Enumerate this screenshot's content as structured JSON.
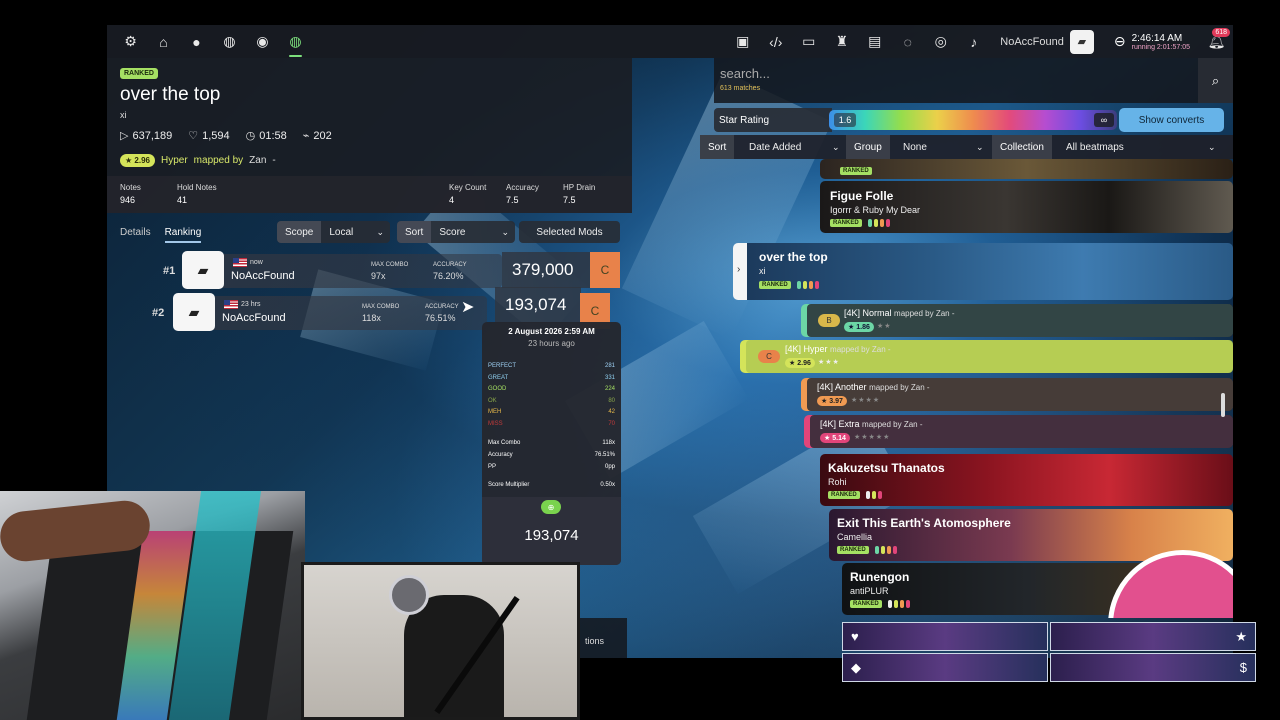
{
  "toolbar": {
    "left_icons": [
      "gear-icon",
      "home-icon",
      "osu-mode-icon",
      "taiko-mode-icon",
      "catch-mode-icon",
      "mania-mode-icon"
    ],
    "right_icons": [
      "rss-icon",
      "code-icon",
      "tv-icon",
      "ranking-icon",
      "wiki-icon",
      "chat-icon",
      "globe-icon",
      "music-icon"
    ],
    "username": "NoAccFound",
    "clock_time": "2:46:14 AM",
    "clock_running": "running 2:01:57:05",
    "notifications": "618"
  },
  "beatmap": {
    "status": "RANKED",
    "title": "over the top",
    "artist": "xi",
    "plays": "637,189",
    "favourites": "1,594",
    "length": "01:58",
    "bpm": "202",
    "star_rating": "2.96",
    "difficulty": "Hyper",
    "mapped_by": "mapped by",
    "mapper": "Zan",
    "dash": "-",
    "stats": [
      {
        "label": "Notes",
        "value": "946"
      },
      {
        "label": "Hold Notes",
        "value": "41"
      },
      {
        "label": "Key Count",
        "value": "4"
      },
      {
        "label": "Accuracy",
        "value": "7.5"
      },
      {
        "label": "HP Drain",
        "value": "7.5"
      }
    ]
  },
  "leaderboard": {
    "tabs": [
      "Details",
      "Ranking"
    ],
    "scope_label": "Scope",
    "scope_value": "Local",
    "sort_label": "Sort",
    "sort_value": "Score",
    "mods_label": "Selected Mods",
    "max_combo_label": "MAX COMBO",
    "accuracy_label": "ACCURACY",
    "scores": [
      {
        "rank": "#1",
        "time": "now",
        "name": "NoAccFound",
        "combo": "97x",
        "accuracy": "76.20%",
        "score": "379,000",
        "grade": "C"
      },
      {
        "rank": "#2",
        "time": "23 hrs",
        "name": "NoAccFound",
        "combo": "118x",
        "accuracy": "76.51%",
        "score": "193,074",
        "grade": "C"
      }
    ]
  },
  "tooltip": {
    "date": "2 August 2026 2:59 AM",
    "ago": "23 hours ago",
    "judgements": [
      {
        "label": "PERFECT",
        "value": "281",
        "color": "#9fd2f5"
      },
      {
        "label": "GREAT",
        "value": "331",
        "color": "#8fd0f0"
      },
      {
        "label": "GOOD",
        "value": "224",
        "color": "#a5e063"
      },
      {
        "label": "OK",
        "value": "80",
        "color": "#8aa74a"
      },
      {
        "label": "MEH",
        "value": "42",
        "color": "#e8b94a"
      },
      {
        "label": "MISS",
        "value": "70",
        "color": "#c43a3a"
      }
    ],
    "details": [
      {
        "label": "Max Combo",
        "value": "118x"
      },
      {
        "label": "Accuracy",
        "value": "76.51%"
      },
      {
        "label": "PP",
        "value": "0pp"
      }
    ],
    "multiplier_label": "Score Multiplier",
    "multiplier_value": "0.50x",
    "score": "193,074"
  },
  "search": {
    "placeholder": "search...",
    "matches": "613 matches",
    "star_rating_label": "Star Rating",
    "star_min": "1.6",
    "star_max": "∞",
    "show_converts": "Show converts",
    "sort_label": "Sort",
    "sort_value": "Date Added",
    "group_label": "Group",
    "group_value": "None",
    "collection_label": "Collection",
    "collection_value": "All beatmaps"
  },
  "carousel": {
    "sets": [
      {
        "title": "Figue Folle",
        "artist": "Igorrr & Ruby My Dear",
        "status": "RANKED"
      },
      {
        "title": "over the top",
        "artist": "xi",
        "status": "RANKED"
      },
      {
        "title": "Kakuzetsu Thanatos",
        "artist": "Rohi",
        "status": "RANKED"
      },
      {
        "title": "Exit This Earth's Atomosphere",
        "artist": "Camellia",
        "status": "RANKED"
      },
      {
        "title": "Runengon",
        "artist": "antiPLUR",
        "status": "RANKED"
      }
    ],
    "difficulties": [
      {
        "name": "[4K] Normal",
        "mapper": "mapped by Zan -",
        "stars": "1.86",
        "grade": "B",
        "color": "#6cd6a6"
      },
      {
        "name": "[4K] Hyper",
        "mapper": "mapped by Zan -",
        "stars": "2.96",
        "grade": "C",
        "color": "#d4e45a"
      },
      {
        "name": "[4K] Another",
        "mapper": "mapped by Zan -",
        "stars": "3.97",
        "grade": "",
        "color": "#f09a52"
      },
      {
        "name": "[4K] Extra",
        "mapper": "mapped by Zan -",
        "stars": "5.14",
        "grade": "",
        "color": "#e2457a"
      }
    ]
  },
  "bottom": {
    "partial_text": "tions"
  },
  "colors": {
    "ranked": "#a5e063",
    "accent": "#66b3e8",
    "grade_c": "#e8824a"
  }
}
